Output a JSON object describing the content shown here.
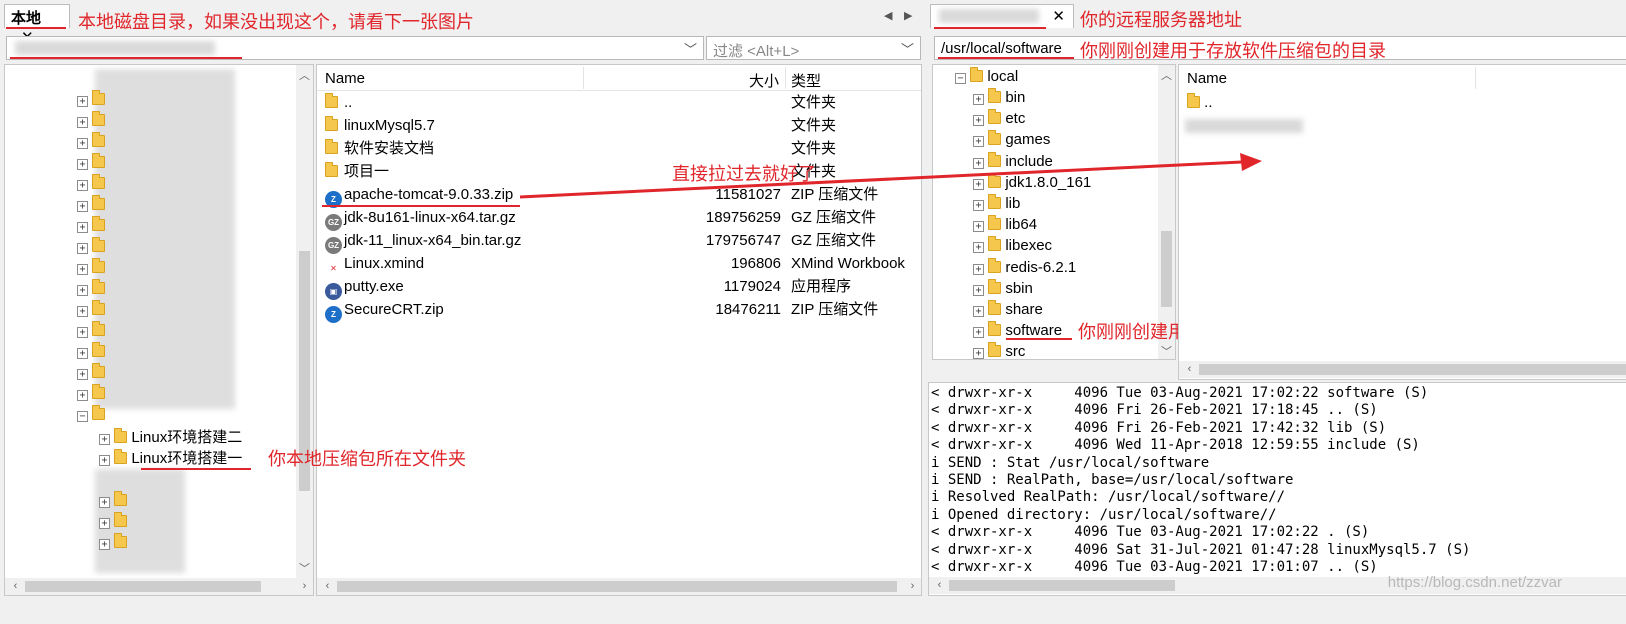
{
  "local": {
    "tab_label": "本地",
    "tab_close": "✕",
    "path_value": "",
    "filter_placeholder": "过滤 <Alt+L>",
    "columns": {
      "name": "Name",
      "size": "大小",
      "type": "类型"
    },
    "files": [
      {
        "name": "..",
        "size": "",
        "type": "文件夹",
        "icon": "folder"
      },
      {
        "name": "linuxMysql5.7",
        "size": "",
        "type": "文件夹",
        "icon": "folder"
      },
      {
        "name": "软件安装文档",
        "size": "",
        "type": "文件夹",
        "icon": "folder"
      },
      {
        "name": "项目一",
        "size": "",
        "type": "文件夹",
        "icon": "folder"
      },
      {
        "name": "apache-tomcat-9.0.33.zip",
        "size": "11581027",
        "type": "ZIP 压缩文件",
        "icon": "zip"
      },
      {
        "name": "jdk-8u161-linux-x64.tar.gz",
        "size": "189756259",
        "type": "GZ 压缩文件",
        "icon": "gz"
      },
      {
        "name": "jdk-11_linux-x64_bin.tar.gz",
        "size": "179756747",
        "type": "GZ 压缩文件",
        "icon": "gz"
      },
      {
        "name": "Linux.xmind",
        "size": "196806",
        "type": "XMind Workbook",
        "icon": "xmind"
      },
      {
        "name": "putty.exe",
        "size": "1179024",
        "type": "应用程序",
        "icon": "exe"
      },
      {
        "name": "SecureCRT.zip",
        "size": "18476211",
        "type": "ZIP 压缩文件",
        "icon": "zip"
      }
    ],
    "tree_items": [
      "Linux环境搭建二",
      "Linux环境搭建一"
    ]
  },
  "remote": {
    "tab_close": "✕",
    "path_value": "/usr/local/software",
    "columns": {
      "name": "Name"
    },
    "tree_root": "local",
    "tree_items": [
      "bin",
      "etc",
      "games",
      "include",
      "jdk1.8.0_161",
      "lib",
      "lib64",
      "libexec",
      "redis-6.2.1",
      "sbin",
      "share",
      "software",
      "src"
    ],
    "files": [
      {
        "name": "..",
        "icon": "folder"
      }
    ]
  },
  "log_lines": [
    "< drwxr-xr-x     4096 Tue 03-Aug-2021 17:02:22 software (S)",
    "< drwxr-xr-x     4096 Fri 26-Feb-2021 17:18:45 .. (S)",
    "< drwxr-xr-x     4096 Fri 26-Feb-2021 17:42:32 lib (S)",
    "< drwxr-xr-x     4096 Wed 11-Apr-2018 12:59:55 include (S)",
    "i SEND : Stat /usr/local/software",
    "i SEND : RealPath, base=/usr/local/software",
    "i Resolved RealPath: /usr/local/software//",
    "i Opened directory: /usr/local/software//",
    "< drwxr-xr-x     4096 Tue 03-Aug-2021 17:02:22 . (S)",
    "< drwxr-xr-x     4096 Sat 31-Jul-2021 01:47:28 linuxMysql5.7 (S)",
    "< drwxr-xr-x     4096 Tue 03-Aug-2021 17:01:07 .. (S)"
  ],
  "annotations": {
    "local_disk": "本地磁盘目录，如果没出现这个，请看下一张图片",
    "remote_addr": "你的远程服务器地址",
    "remote_dir": "你刚刚创建用于存放软件压缩包的目录",
    "drag_hint": "直接拉过去就好了",
    "tree_dir": "你刚刚创建用于存放软件压缩包的目录",
    "local_folder": "你本地压缩包所在文件夹"
  },
  "watermark": "https://blog.csdn.net/zzvar",
  "colors": {
    "annotation": "#e0262b",
    "folder": "#f5c84d",
    "background": "#f0f0f0"
  }
}
